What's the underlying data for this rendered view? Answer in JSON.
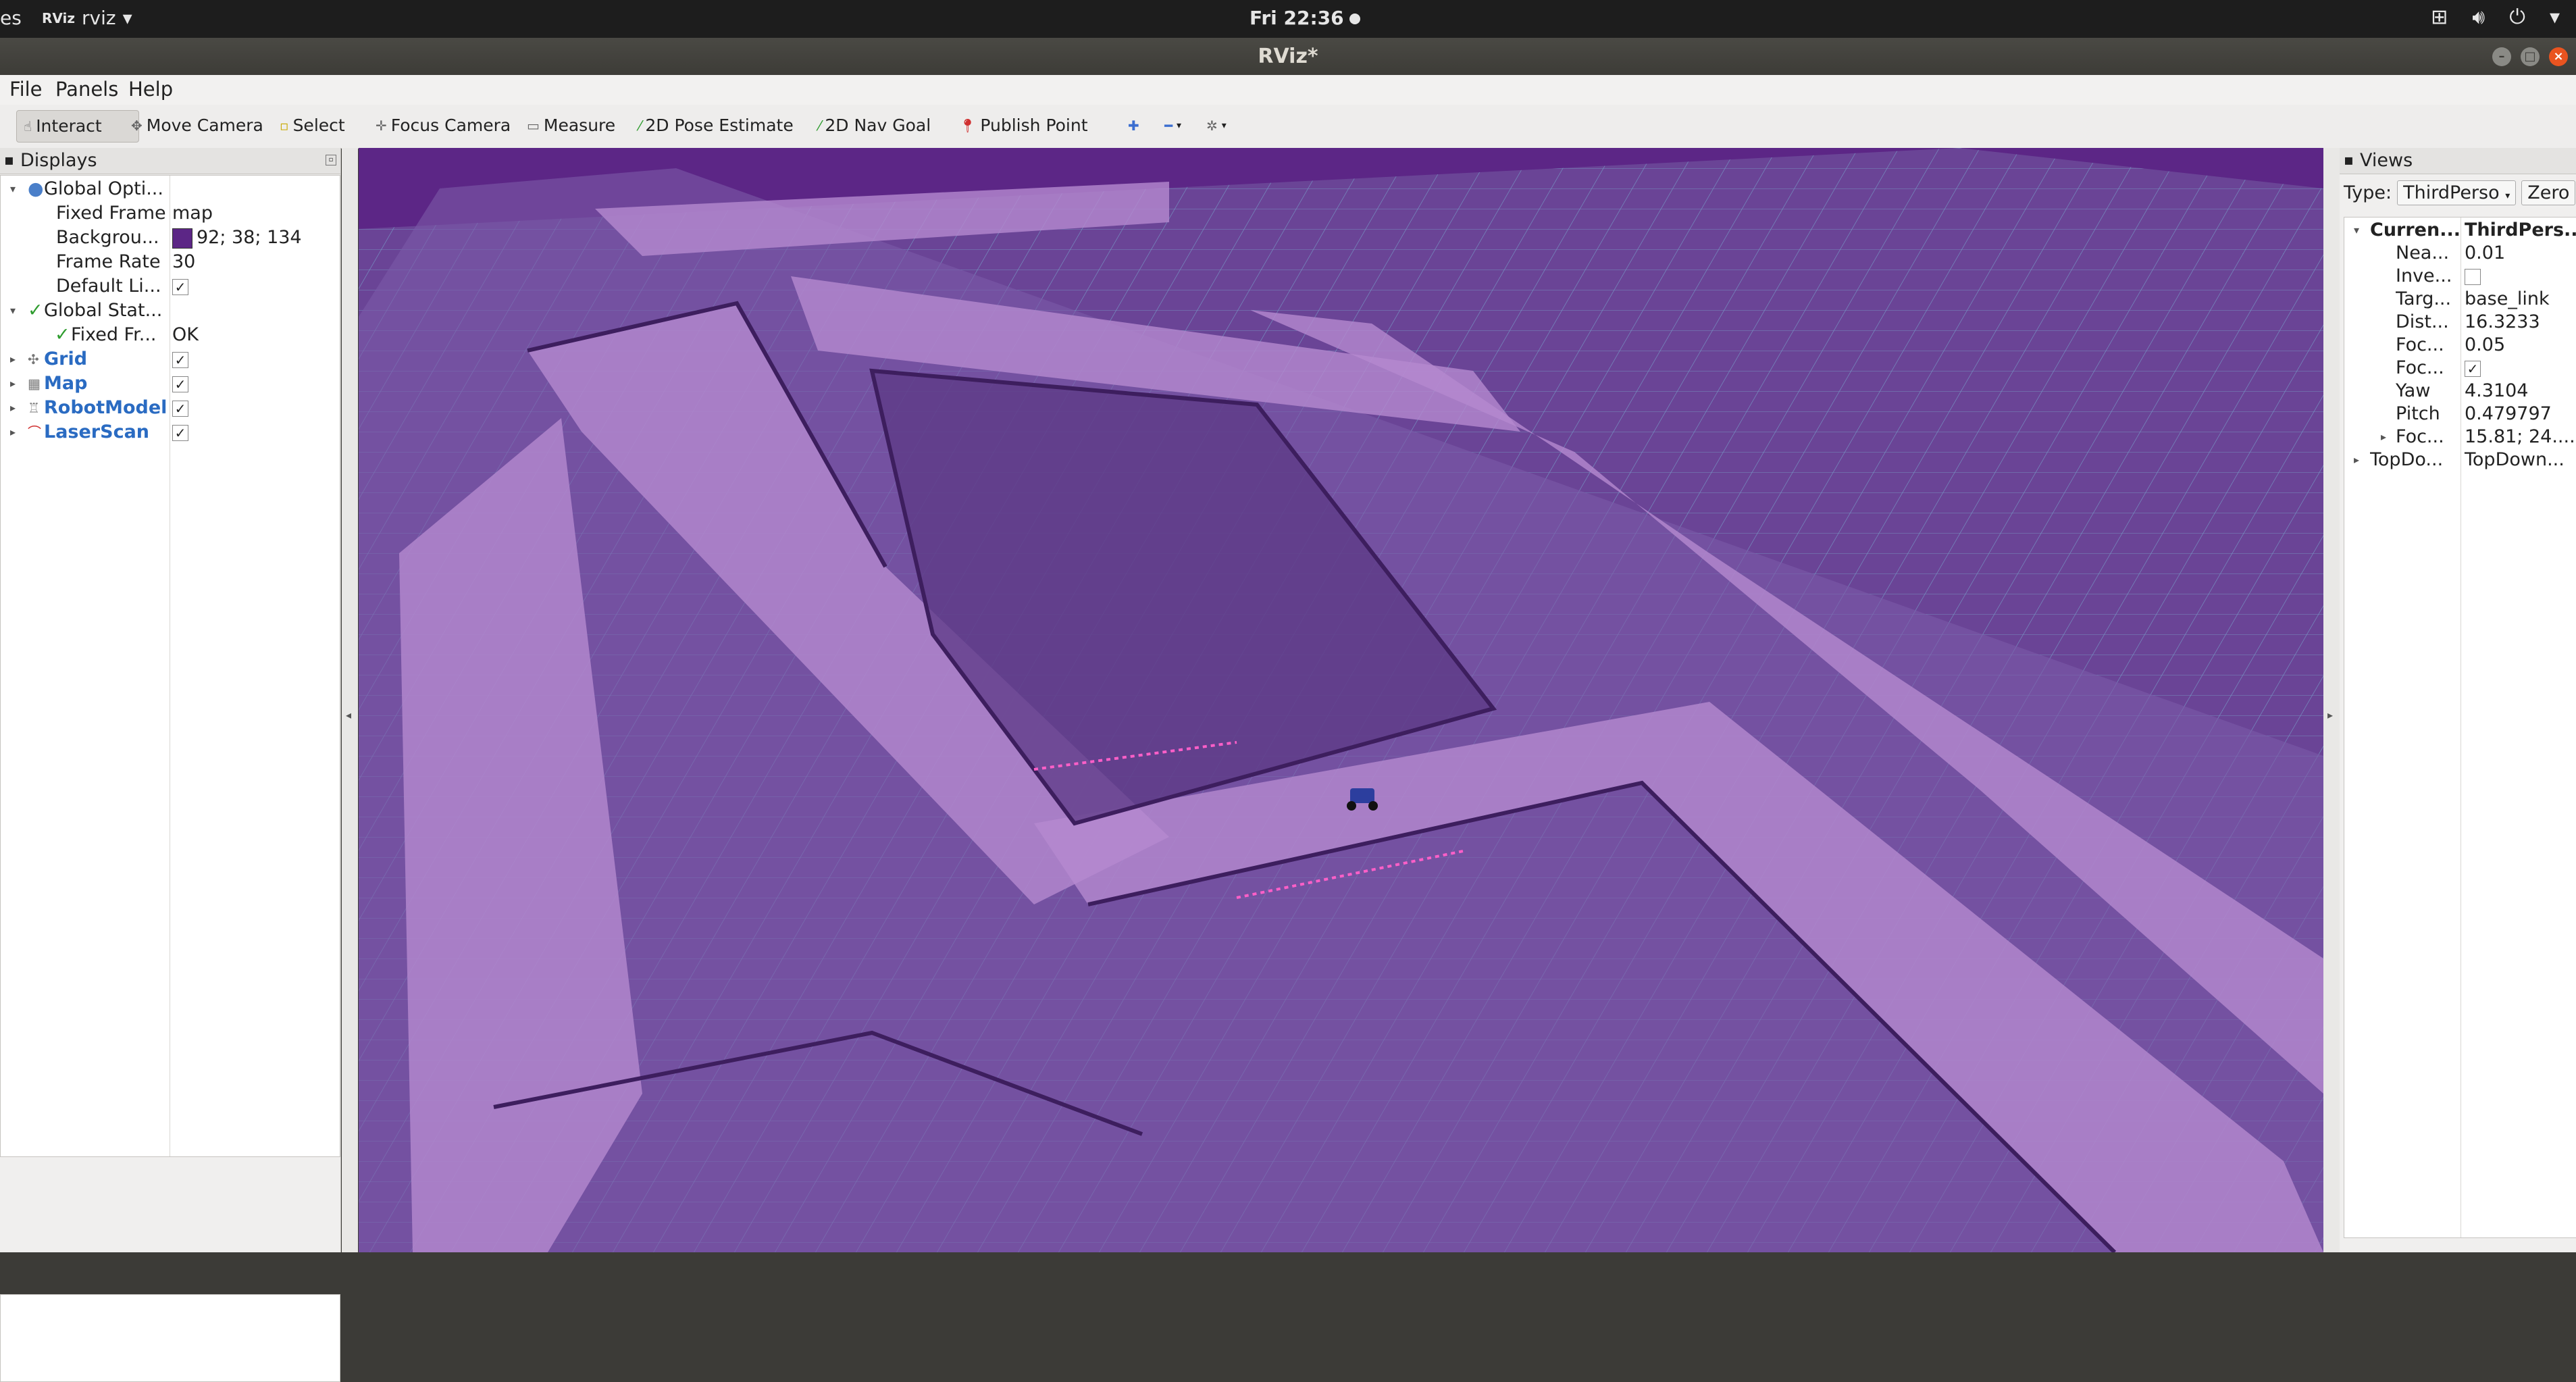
{
  "topbar": {
    "activities": "es",
    "app_logo": "RViz",
    "app_name": "rviz",
    "clock": "Fri 22:36",
    "tray_icons": [
      "network-icon",
      "volume-icon",
      "power-icon",
      "chevron-down-icon"
    ]
  },
  "window": {
    "title": "RViz*"
  },
  "menu": {
    "file": "File",
    "panels": "Panels",
    "help": "Help"
  },
  "toolbar": {
    "interact": "Interact",
    "move_camera": "Move Camera",
    "select": "Select",
    "focus_camera": "Focus Camera",
    "measure": "Measure",
    "pose_estimate": "2D Pose Estimate",
    "nav_goal": "2D Nav Goal",
    "publish_point": "Publish Point"
  },
  "displays": {
    "title": "Displays",
    "global_options": "Global Opti...",
    "fixed_frame_label": "Fixed Frame",
    "fixed_frame_value": "map",
    "background_label": "Backgrou...",
    "background_value": "92; 38; 134",
    "background_color": "#5c2686",
    "frame_rate_label": "Frame Rate",
    "frame_rate_value": "30",
    "default_light_label": "Default Li...",
    "global_status": "Global Stat...",
    "fixed_frame_status_label": "Fixed Fr...",
    "fixed_frame_status_value": "OK",
    "items": [
      "Grid",
      "Map",
      "RobotModel",
      "LaserScan"
    ]
  },
  "views": {
    "title": "Views",
    "type_label": "Type:",
    "type_value": "ThirdPerso",
    "zero_button": "Zero",
    "current_label": "Curren...",
    "current_value": "ThirdPers...",
    "near_label": "Nea...",
    "near_value": "0.01",
    "invert_label": "Inve...",
    "target_label": "Targ...",
    "target_value": "base_link",
    "distance_label": "Dist...",
    "distance_value": "16.3233",
    "focal_size_label": "Foc...",
    "focal_size_value": "0.05",
    "focal_shape_label": "Foc...",
    "yaw_label": "Yaw",
    "yaw_value": "4.3104",
    "pitch_label": "Pitch",
    "pitch_value": "0.479797",
    "focal_point_label": "Foc...",
    "focal_point_value": "15.81; 24....",
    "topdown_label": "TopDo...",
    "topdown_value": "TopDown..."
  }
}
